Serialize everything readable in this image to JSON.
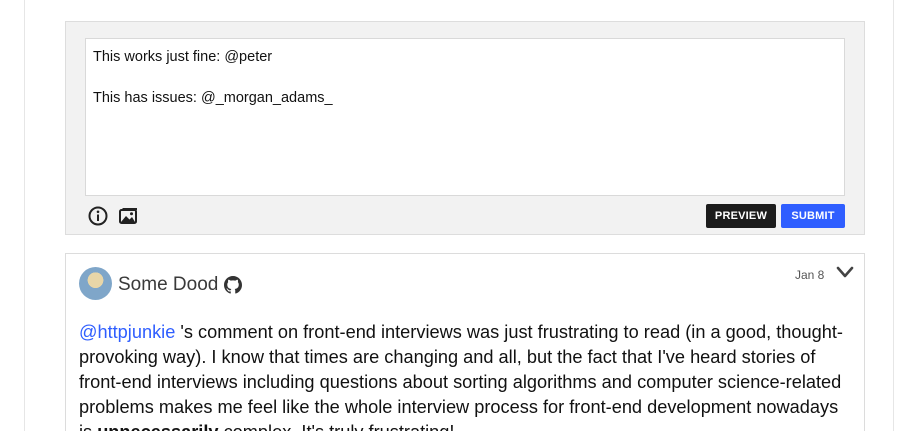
{
  "composer": {
    "lines": [
      "This works just fine: @peter",
      "This has issues: @_morgan_adams_"
    ],
    "preview_label": "PREVIEW",
    "submit_label": "SUBMIT",
    "icons": [
      "info-icon",
      "image-icon"
    ]
  },
  "comment": {
    "author": "Some Dood",
    "date": "Jan 8",
    "mention": "@httpjunkie",
    "text_before_bold": " 's comment on front-end interviews was just frustrating to read (in a good, thought-provoking way). I know that times are changing and all, but the fact that I've heard stories of front-end interviews including questions about sorting algorithms and computer science-related problems makes me feel like the whole interview process for front-end development nowadays is ",
    "bold": "unnecessarily",
    "text_after_bold": " complex. It's truly frustrating!",
    "icons": [
      "github-icon",
      "chevron-down-icon"
    ]
  },
  "colors": {
    "accent": "#2f5eff",
    "preview_bg": "#1c1c1c"
  }
}
